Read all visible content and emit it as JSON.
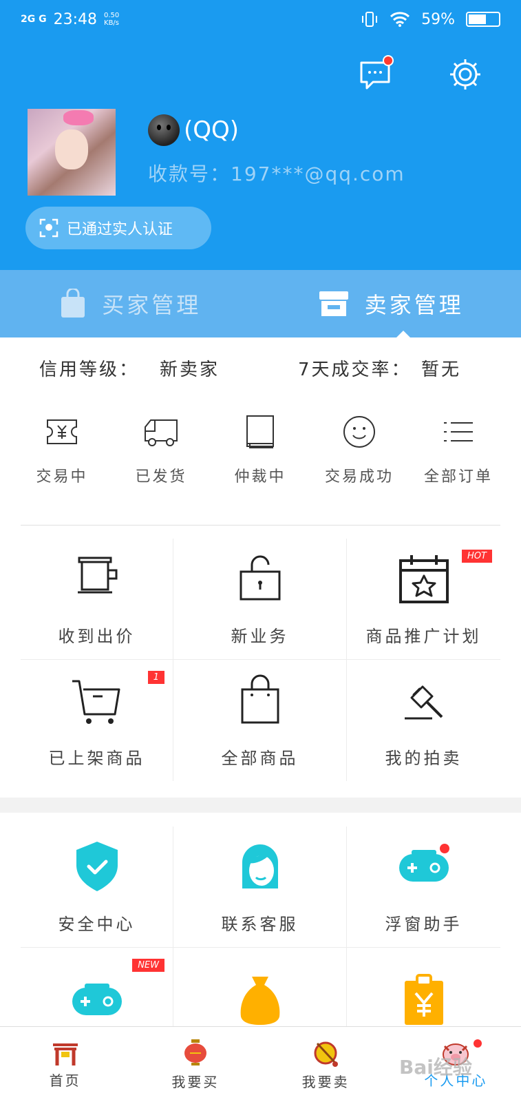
{
  "status_bar": {
    "network": "2G G",
    "time": "23:48",
    "speed_value": "0.50",
    "speed_unit": "KB/s",
    "battery": "59%",
    "battery_level": 0.59
  },
  "profile": {
    "name": "(QQ)",
    "account": "收款号：197***@qq.com",
    "verified": "已通过实人认证"
  },
  "tabs": [
    {
      "label": "买家管理",
      "active": false
    },
    {
      "label": "卖家管理",
      "active": true
    }
  ],
  "stats": {
    "credit_label": "信用等级：",
    "credit_value": "新卖家",
    "rate_label": "7天成交率：",
    "rate_value": "暂无"
  },
  "orders": [
    {
      "label": "交易中",
      "icon": "yuan-receipt-icon"
    },
    {
      "label": "已发货",
      "icon": "truck-icon"
    },
    {
      "label": "仲裁中",
      "icon": "book-icon"
    },
    {
      "label": "交易成功",
      "icon": "smile-icon"
    },
    {
      "label": "全部订单",
      "icon": "list-icon"
    }
  ],
  "seller_grid": [
    {
      "label": "收到出价",
      "icon": "offer-icon",
      "badge": ""
    },
    {
      "label": "新业务",
      "icon": "lock-icon",
      "badge": ""
    },
    {
      "label": "商品推广计划",
      "icon": "calendar-star-icon",
      "badge": "HOT"
    },
    {
      "label": "已上架商品",
      "icon": "cart-icon",
      "badge": "1"
    },
    {
      "label": "全部商品",
      "icon": "bag-icon",
      "badge": ""
    },
    {
      "label": "我的拍卖",
      "icon": "gavel-icon",
      "badge": ""
    }
  ],
  "services_grid": [
    {
      "label": "安全中心",
      "icon": "shield-icon",
      "badge": ""
    },
    {
      "label": "联系客服",
      "icon": "customer-service-icon",
      "badge": ""
    },
    {
      "label": "浮窗助手",
      "icon": "gamepad-icon",
      "badge": ""
    },
    {
      "label": "",
      "icon": "gamepad-icon",
      "badge": "NEW"
    },
    {
      "label": "",
      "icon": "money-bag-icon",
      "badge": ""
    },
    {
      "label": "",
      "icon": "yuan-clipboard-icon",
      "badge": ""
    }
  ],
  "bottom_nav": [
    {
      "label": "首页",
      "icon": "gate-icon",
      "active": false
    },
    {
      "label": "我要买",
      "icon": "lantern-icon",
      "active": false
    },
    {
      "label": "我要卖",
      "icon": "drum-icon",
      "active": false
    },
    {
      "label": "个人中心",
      "icon": "pig-icon",
      "active": true
    }
  ],
  "watermark": "Bai经验",
  "colors": {
    "primary": "#1a9bf0",
    "tab_bar": "#60b3f0",
    "accent_cyan": "#1fc8d8",
    "accent_orange": "#ffb000",
    "badge_red": "#ff3333"
  }
}
